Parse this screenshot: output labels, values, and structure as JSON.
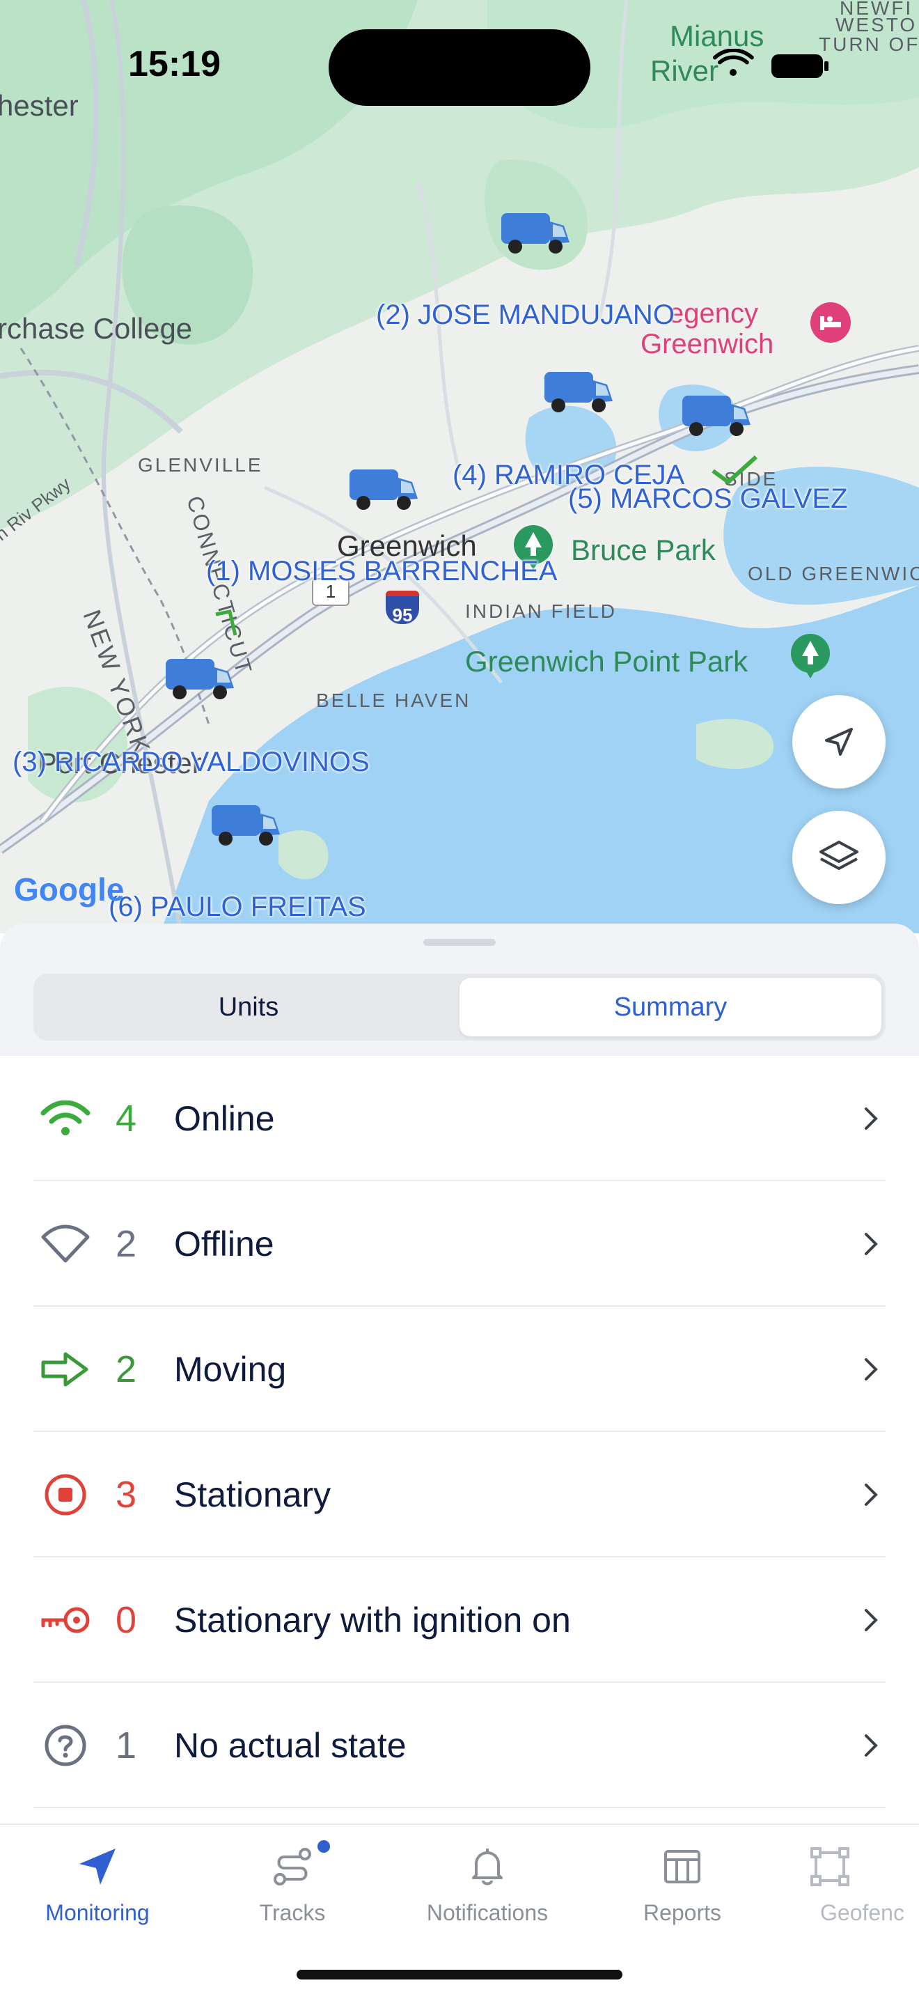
{
  "status_bar": {
    "time": "15:19"
  },
  "map": {
    "place_labels": {
      "chester": "hester",
      "mianus": "Mianus",
      "river": "River",
      "park_suffix": "Park",
      "newfield": "NEWFI",
      "westo": "WESTO",
      "turn": "TURN OF",
      "purchase": "rchase College",
      "glenville": "GLENVILLE",
      "greenwich": "Greenwich",
      "bruce_park": "Bruce Park",
      "old_greenwich": "OLD GREENWIC",
      "indian_field": "INDIAN FIELD",
      "greenwich_point": "Greenwich Point Park",
      "belle_haven": "BELLE HAVEN",
      "new_york": "NEW YORK",
      "connecticut": "CONNECTICUT",
      "port_chester": "Port Chester",
      "riverside": "SIDE",
      "hyatt": "egency",
      "hyatt_line2": "Greenwich",
      "parkway": "on Riv Pkwy",
      "route1": "1",
      "route95": "95"
    },
    "units": [
      {
        "label": "(1) MOSIES BARRENCHEA"
      },
      {
        "label": "(2) JOSE MANDUJANO"
      },
      {
        "label": "(3) RICARDO VALDOVINOS"
      },
      {
        "label": "(4)  RAMIRO CEJA"
      },
      {
        "label": "(5) MARCOS GALVEZ"
      },
      {
        "label": "(6) PAULO FREITAS"
      }
    ],
    "attribution": "Google",
    "buttons": {
      "locate": "location-arrow-icon",
      "layers": "layers-icon"
    }
  },
  "segmented": {
    "units": "Units",
    "summary": "Summary",
    "active": "summary"
  },
  "summary": [
    {
      "icon": "wifi-icon",
      "count": "4",
      "label": "Online",
      "color": "#3daa3d"
    },
    {
      "icon": "wifi-off-icon",
      "count": "2",
      "label": "Offline",
      "color": "#6b7180"
    },
    {
      "icon": "arrow-right-icon",
      "count": "2",
      "label": "Moving",
      "color": "#3a9a3a"
    },
    {
      "icon": "stop-circle-icon",
      "count": "3",
      "label": "Stationary",
      "color": "#e0423a"
    },
    {
      "icon": "key-icon",
      "count": "0",
      "label": "Stationary with ignition on",
      "color": "#e0423a"
    },
    {
      "icon": "question-circle-icon",
      "count": "1",
      "label": "No actual state",
      "color": "#6b7180"
    }
  ],
  "tabs": [
    {
      "label": "Monitoring",
      "icon": "navigation-arrow-icon",
      "active": true
    },
    {
      "label": "Tracks",
      "icon": "route-icon",
      "badge": true
    },
    {
      "label": "Notifications",
      "icon": "bell-icon"
    },
    {
      "label": "Reports",
      "icon": "table-icon"
    },
    {
      "label": "Geofenc",
      "icon": "geofence-icon"
    }
  ]
}
